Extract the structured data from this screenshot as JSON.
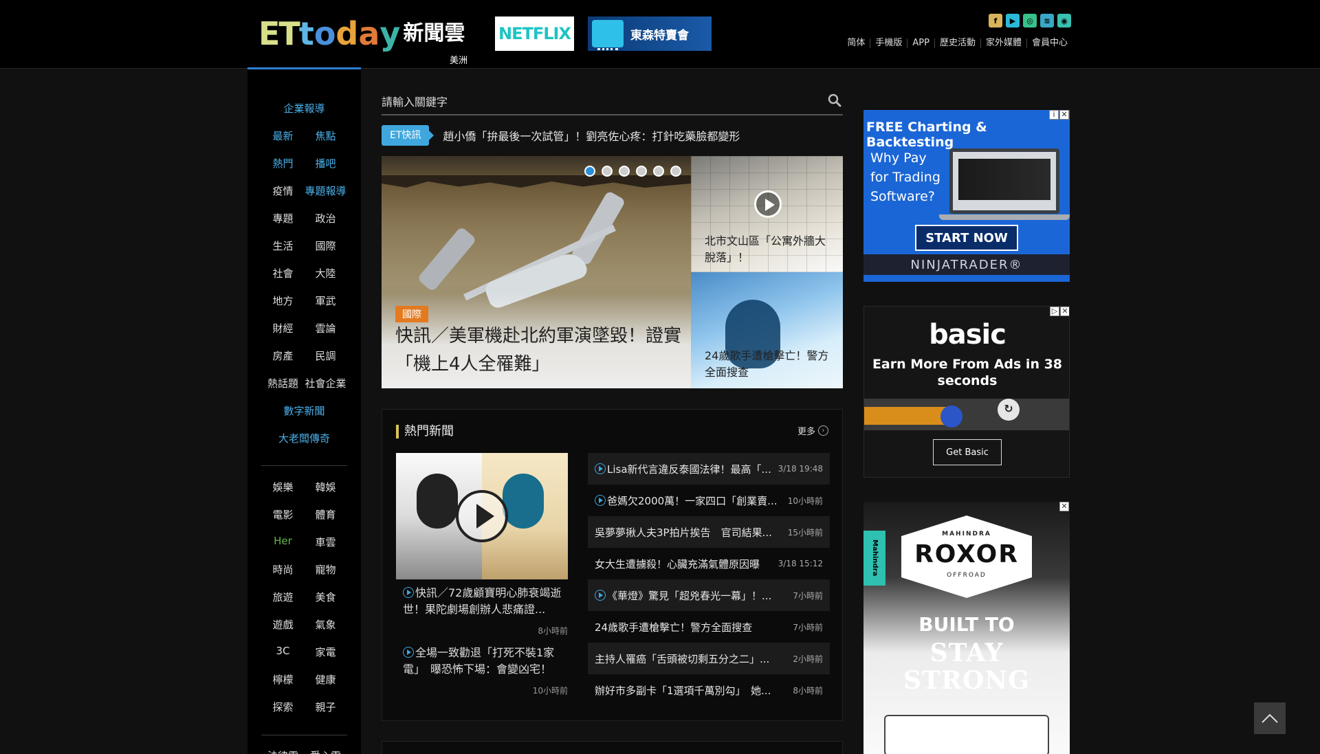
{
  "header": {
    "logo": {
      "et": "ET",
      "t": "t",
      "o": "o",
      "d": "d",
      "a": "a",
      "y": "y",
      "cn": "新聞雲"
    },
    "region": "美洲",
    "netflix_ad": "NETFLIX",
    "sale_ad": "東森特賣會",
    "social": [
      "f",
      "▶",
      "◎",
      "≋",
      "◉"
    ],
    "links": [
      "简体",
      "手機版",
      "APP",
      "歷史活動",
      "家外媒體",
      "會員中心"
    ]
  },
  "leftnav": {
    "enterprise": "企業報導",
    "pairs1": [
      [
        "最新",
        "焦點"
      ],
      [
        "熱門",
        "播吧"
      ],
      [
        "疫情",
        "專題報導"
      ],
      [
        "專題",
        "政治"
      ],
      [
        "生活",
        "國際"
      ],
      [
        "社會",
        "大陸"
      ],
      [
        "地方",
        "軍武"
      ],
      [
        "財經",
        "雲論"
      ],
      [
        "房產",
        "民調"
      ],
      [
        "熱話題",
        "社會企業"
      ]
    ],
    "digital": "數字新聞",
    "boss": "大老闆傳奇",
    "pairs2": [
      [
        "娛樂",
        "韓娛"
      ],
      [
        "電影",
        "體育"
      ],
      [
        "Her",
        "車雲"
      ],
      [
        "時尚",
        "寵物"
      ],
      [
        "旅遊",
        "美食"
      ],
      [
        "遊戲",
        "氣象"
      ],
      [
        "3C",
        "家電"
      ],
      [
        "檸檬",
        "健康"
      ],
      [
        "探索",
        "親子"
      ]
    ],
    "pairs3": [
      [
        "法律雲",
        "愛心雲"
      ]
    ]
  },
  "search": {
    "placeholder": "請輸入關鍵字"
  },
  "flash": {
    "tag": "ET快訊",
    "text": "趙小僑「拚最後一次試管」！劉亮佐心疼：打針吃藥臉都變形"
  },
  "hero": {
    "tag": "國際",
    "title": "快訊／美軍機赴北約軍演墜毀！證實「機上4人全罹難」",
    "dots": 6,
    "active_dot": 0
  },
  "side_cards": [
    {
      "caption": "北市文山區「公寓外牆大脫落」！"
    },
    {
      "caption": "24歲歌手遭槍擊亡！警方全面搜查"
    }
  ],
  "hot": {
    "title": "熱門新聞",
    "more": "更多",
    "left_items": [
      {
        "text": "快訊／72歲顧寶明心肺衰竭逝世！果陀劇場創辦人悲痛證...",
        "time": "8小時前",
        "video": true
      },
      {
        "text": "全場一致勸退「打死不裝1家電」　曝恐怖下場：會變凶宅！",
        "time": "10小時前",
        "video": true
      }
    ],
    "list": [
      {
        "text": "Lisa新代言違反泰國法律！最高「...",
        "time": "3/18 19:48",
        "video": true
      },
      {
        "text": "爸媽欠2000萬！一家四口「創業賣...",
        "time": "10小時前",
        "video": true
      },
      {
        "text": "吳夢夢揪人夫3P拍片挨告　官司結果...",
        "time": "15小時前",
        "video": false
      },
      {
        "text": "女大生遭擄殺！心臟充滿氣體原因曝",
        "time": "3/18 15:12",
        "video": false
      },
      {
        "text": "《華燈》驚見「超兇春光一幕」！...",
        "time": "7小時前",
        "video": true
      },
      {
        "text": "24歲歌手遭槍擊亡！警方全面搜查",
        "time": "7小時前",
        "video": false
      },
      {
        "text": "主持人罹癌「舌頭被切剩五分之二」...",
        "time": "2小時前",
        "video": false
      },
      {
        "text": "辦好市多副卡「1選項千萬別勾」　她...",
        "time": "8小時前",
        "video": false
      }
    ]
  },
  "ads": {
    "ninja": {
      "headline": "FREE Charting & Backtesting",
      "question": "Why Pay for Trading Software?",
      "cta": "START NOW",
      "brand": "NINJATRADER®"
    },
    "basic": {
      "logo": "basic",
      "text": "Earn More From Ads in 38 seconds",
      "cta": "Get Basic",
      "progress": 0.43
    },
    "roxor": {
      "side": "Mahindra",
      "mahindra": "MAHINDRA",
      "logo": "ROXOR",
      "offroad": "OFFROAD",
      "built": "BUILT TO",
      "strong": "STAY STRONG"
    }
  },
  "colors": {
    "accent": "#4ab0ea",
    "flash": "#3fa7de",
    "tag": "#e37a1f",
    "her": "#62b84a"
  }
}
